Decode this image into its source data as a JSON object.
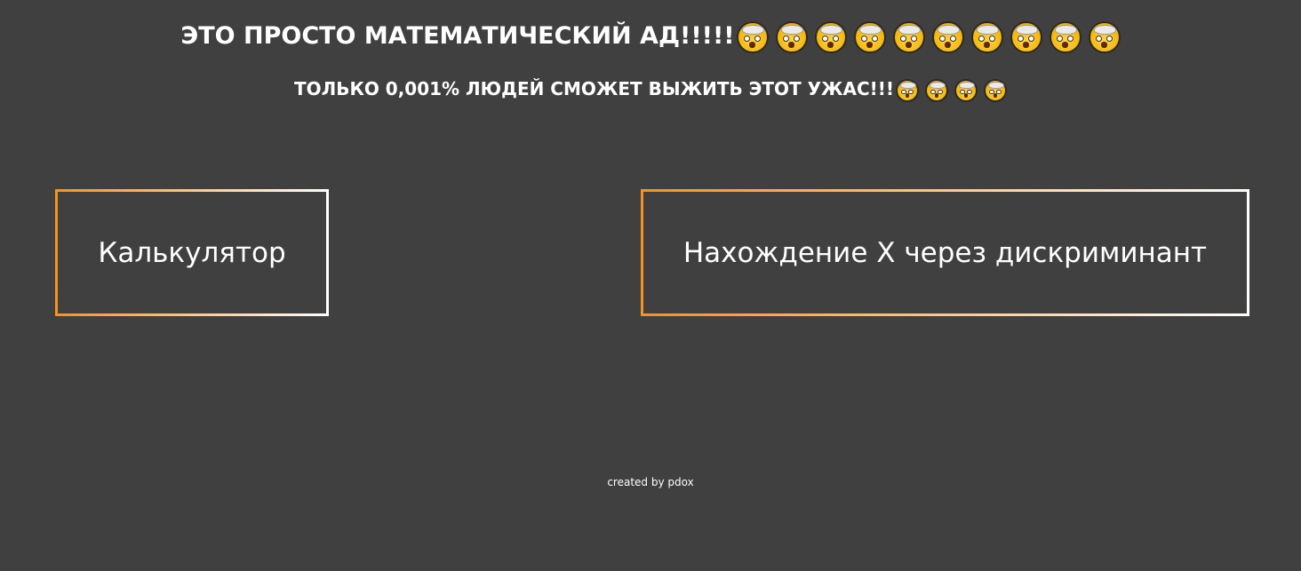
{
  "header": {
    "title": "ЭТО ПРОСТО МАТЕМАТИЧЕСКИЙ АД!!!!!",
    "title_emoji_count": 10,
    "subtitle": "ТОЛЬКО 0,001% ЛЮДЕЙ СМОЖЕТ ВЫЖИТЬ ЭТОТ УЖАС!!!",
    "subtitle_emoji_count": 4,
    "emoji_icon": "exploding-head-icon"
  },
  "nav": {
    "calculator_label": "Калькулятор",
    "discriminant_label": "Нахождение X через дискриминант"
  },
  "footer": {
    "credit": "created by pdox"
  },
  "colors": {
    "background": "#404040",
    "border_gradient_start": "#f7921e",
    "border_gradient_end": "#ffffff",
    "text": "#ffffff"
  }
}
